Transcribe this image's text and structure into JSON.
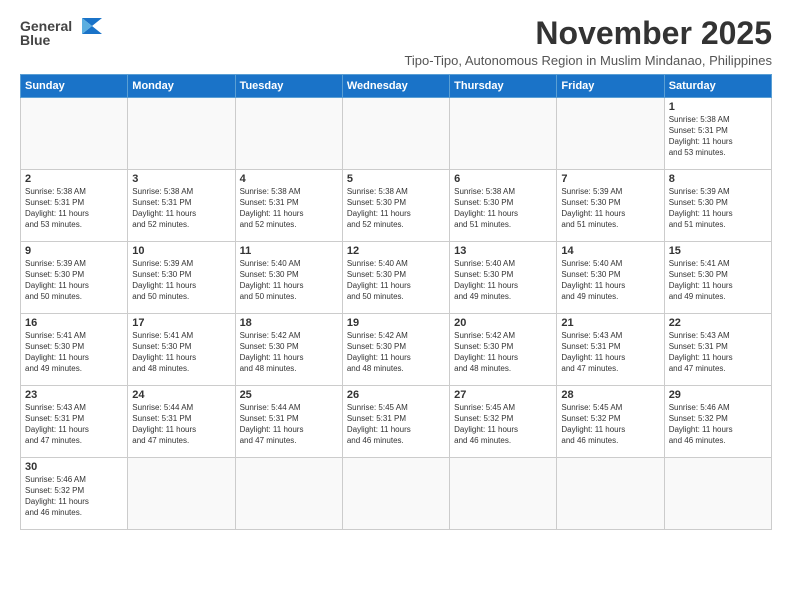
{
  "logo": {
    "line1": "General",
    "line2": "Blue"
  },
  "title": "November 2025",
  "subtitle": "Tipo-Tipo, Autonomous Region in Muslim Mindanao, Philippines",
  "days_of_week": [
    "Sunday",
    "Monday",
    "Tuesday",
    "Wednesday",
    "Thursday",
    "Friday",
    "Saturday"
  ],
  "weeks": [
    [
      {
        "day": "",
        "info": ""
      },
      {
        "day": "",
        "info": ""
      },
      {
        "day": "",
        "info": ""
      },
      {
        "day": "",
        "info": ""
      },
      {
        "day": "",
        "info": ""
      },
      {
        "day": "",
        "info": ""
      },
      {
        "day": "1",
        "info": "Sunrise: 5:38 AM\nSunset: 5:31 PM\nDaylight: 11 hours\nand 53 minutes."
      }
    ],
    [
      {
        "day": "2",
        "info": "Sunrise: 5:38 AM\nSunset: 5:31 PM\nDaylight: 11 hours\nand 53 minutes."
      },
      {
        "day": "3",
        "info": "Sunrise: 5:38 AM\nSunset: 5:31 PM\nDaylight: 11 hours\nand 52 minutes."
      },
      {
        "day": "4",
        "info": "Sunrise: 5:38 AM\nSunset: 5:31 PM\nDaylight: 11 hours\nand 52 minutes."
      },
      {
        "day": "5",
        "info": "Sunrise: 5:38 AM\nSunset: 5:30 PM\nDaylight: 11 hours\nand 52 minutes."
      },
      {
        "day": "6",
        "info": "Sunrise: 5:38 AM\nSunset: 5:30 PM\nDaylight: 11 hours\nand 51 minutes."
      },
      {
        "day": "7",
        "info": "Sunrise: 5:39 AM\nSunset: 5:30 PM\nDaylight: 11 hours\nand 51 minutes."
      },
      {
        "day": "8",
        "info": "Sunrise: 5:39 AM\nSunset: 5:30 PM\nDaylight: 11 hours\nand 51 minutes."
      }
    ],
    [
      {
        "day": "9",
        "info": "Sunrise: 5:39 AM\nSunset: 5:30 PM\nDaylight: 11 hours\nand 50 minutes."
      },
      {
        "day": "10",
        "info": "Sunrise: 5:39 AM\nSunset: 5:30 PM\nDaylight: 11 hours\nand 50 minutes."
      },
      {
        "day": "11",
        "info": "Sunrise: 5:40 AM\nSunset: 5:30 PM\nDaylight: 11 hours\nand 50 minutes."
      },
      {
        "day": "12",
        "info": "Sunrise: 5:40 AM\nSunset: 5:30 PM\nDaylight: 11 hours\nand 50 minutes."
      },
      {
        "day": "13",
        "info": "Sunrise: 5:40 AM\nSunset: 5:30 PM\nDaylight: 11 hours\nand 49 minutes."
      },
      {
        "day": "14",
        "info": "Sunrise: 5:40 AM\nSunset: 5:30 PM\nDaylight: 11 hours\nand 49 minutes."
      },
      {
        "day": "15",
        "info": "Sunrise: 5:41 AM\nSunset: 5:30 PM\nDaylight: 11 hours\nand 49 minutes."
      }
    ],
    [
      {
        "day": "16",
        "info": "Sunrise: 5:41 AM\nSunset: 5:30 PM\nDaylight: 11 hours\nand 49 minutes."
      },
      {
        "day": "17",
        "info": "Sunrise: 5:41 AM\nSunset: 5:30 PM\nDaylight: 11 hours\nand 48 minutes."
      },
      {
        "day": "18",
        "info": "Sunrise: 5:42 AM\nSunset: 5:30 PM\nDaylight: 11 hours\nand 48 minutes."
      },
      {
        "day": "19",
        "info": "Sunrise: 5:42 AM\nSunset: 5:30 PM\nDaylight: 11 hours\nand 48 minutes."
      },
      {
        "day": "20",
        "info": "Sunrise: 5:42 AM\nSunset: 5:30 PM\nDaylight: 11 hours\nand 48 minutes."
      },
      {
        "day": "21",
        "info": "Sunrise: 5:43 AM\nSunset: 5:31 PM\nDaylight: 11 hours\nand 47 minutes."
      },
      {
        "day": "22",
        "info": "Sunrise: 5:43 AM\nSunset: 5:31 PM\nDaylight: 11 hours\nand 47 minutes."
      }
    ],
    [
      {
        "day": "23",
        "info": "Sunrise: 5:43 AM\nSunset: 5:31 PM\nDaylight: 11 hours\nand 47 minutes."
      },
      {
        "day": "24",
        "info": "Sunrise: 5:44 AM\nSunset: 5:31 PM\nDaylight: 11 hours\nand 47 minutes."
      },
      {
        "day": "25",
        "info": "Sunrise: 5:44 AM\nSunset: 5:31 PM\nDaylight: 11 hours\nand 47 minutes."
      },
      {
        "day": "26",
        "info": "Sunrise: 5:45 AM\nSunset: 5:31 PM\nDaylight: 11 hours\nand 46 minutes."
      },
      {
        "day": "27",
        "info": "Sunrise: 5:45 AM\nSunset: 5:32 PM\nDaylight: 11 hours\nand 46 minutes."
      },
      {
        "day": "28",
        "info": "Sunrise: 5:45 AM\nSunset: 5:32 PM\nDaylight: 11 hours\nand 46 minutes."
      },
      {
        "day": "29",
        "info": "Sunrise: 5:46 AM\nSunset: 5:32 PM\nDaylight: 11 hours\nand 46 minutes."
      }
    ],
    [
      {
        "day": "30",
        "info": "Sunrise: 5:46 AM\nSunset: 5:32 PM\nDaylight: 11 hours\nand 46 minutes."
      },
      {
        "day": "",
        "info": ""
      },
      {
        "day": "",
        "info": ""
      },
      {
        "day": "",
        "info": ""
      },
      {
        "day": "",
        "info": ""
      },
      {
        "day": "",
        "info": ""
      },
      {
        "day": "",
        "info": ""
      }
    ]
  ]
}
